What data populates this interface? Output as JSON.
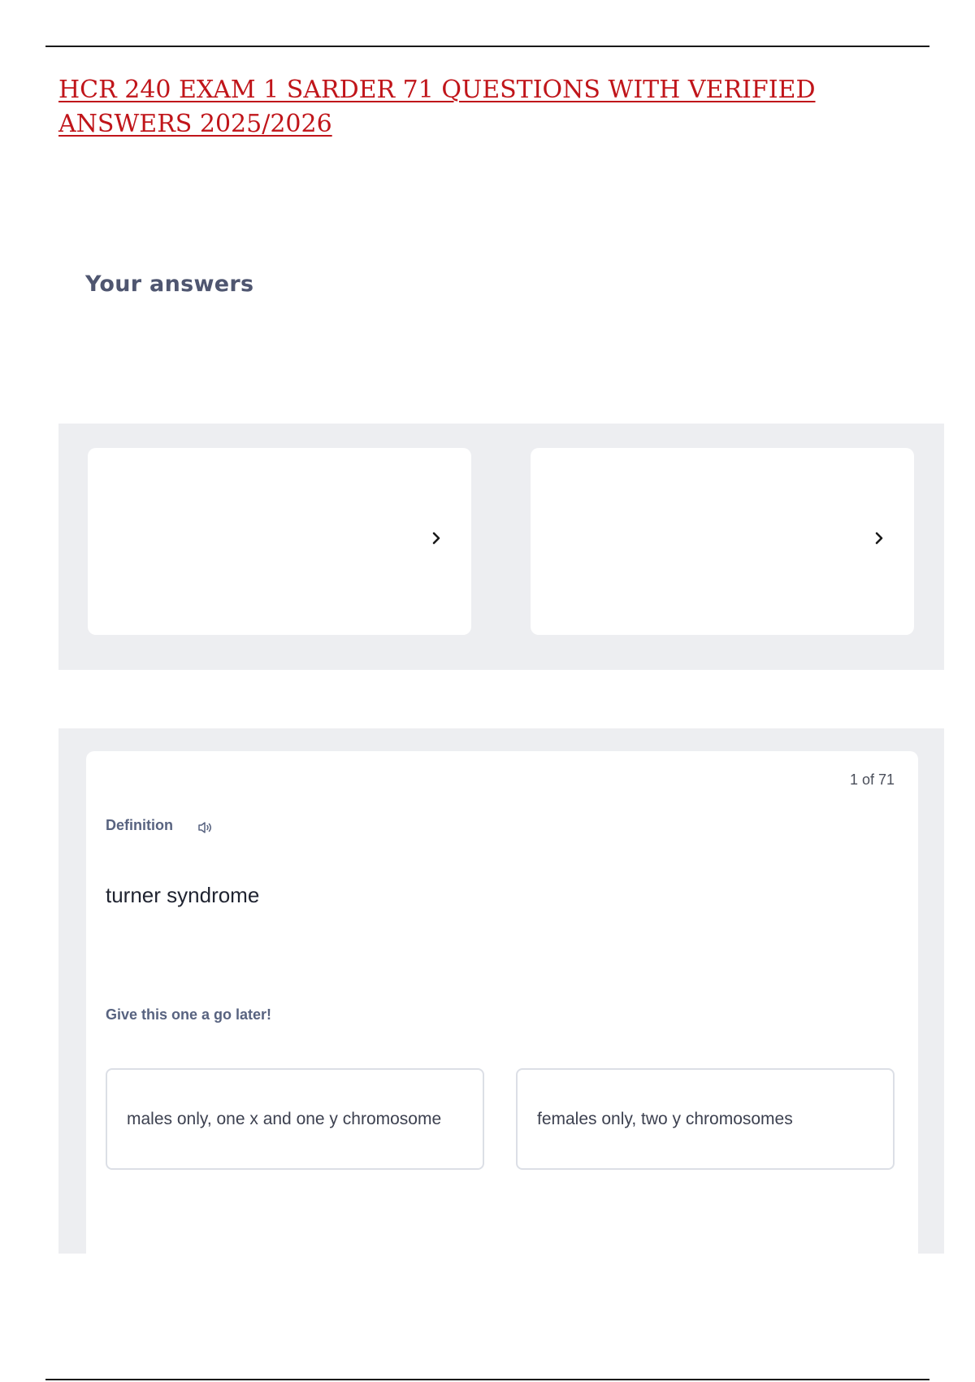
{
  "document": {
    "title": "HCR 240 EXAM 1 SARDER 71 QUESTIONS WITH VERIFIED ANSWERS 2025/2026"
  },
  "answers_section": {
    "heading": "Your answers",
    "cards": [
      {
        "icon": "chevron-right-icon"
      },
      {
        "icon": "chevron-right-icon"
      }
    ]
  },
  "flashcard": {
    "counter": "1 of 71",
    "side_label": "Definition",
    "audio_icon": "speaker-icon",
    "term": "turner syndrome",
    "hint": "Give this one a go later!",
    "options": [
      "males only, one x and one y chromosome",
      "females only, two y chromosomes"
    ]
  },
  "colors": {
    "title_red": "#c0151a",
    "heading_slate": "#4f5670",
    "panel_gray": "#edeef1",
    "label_gray": "#586380"
  }
}
